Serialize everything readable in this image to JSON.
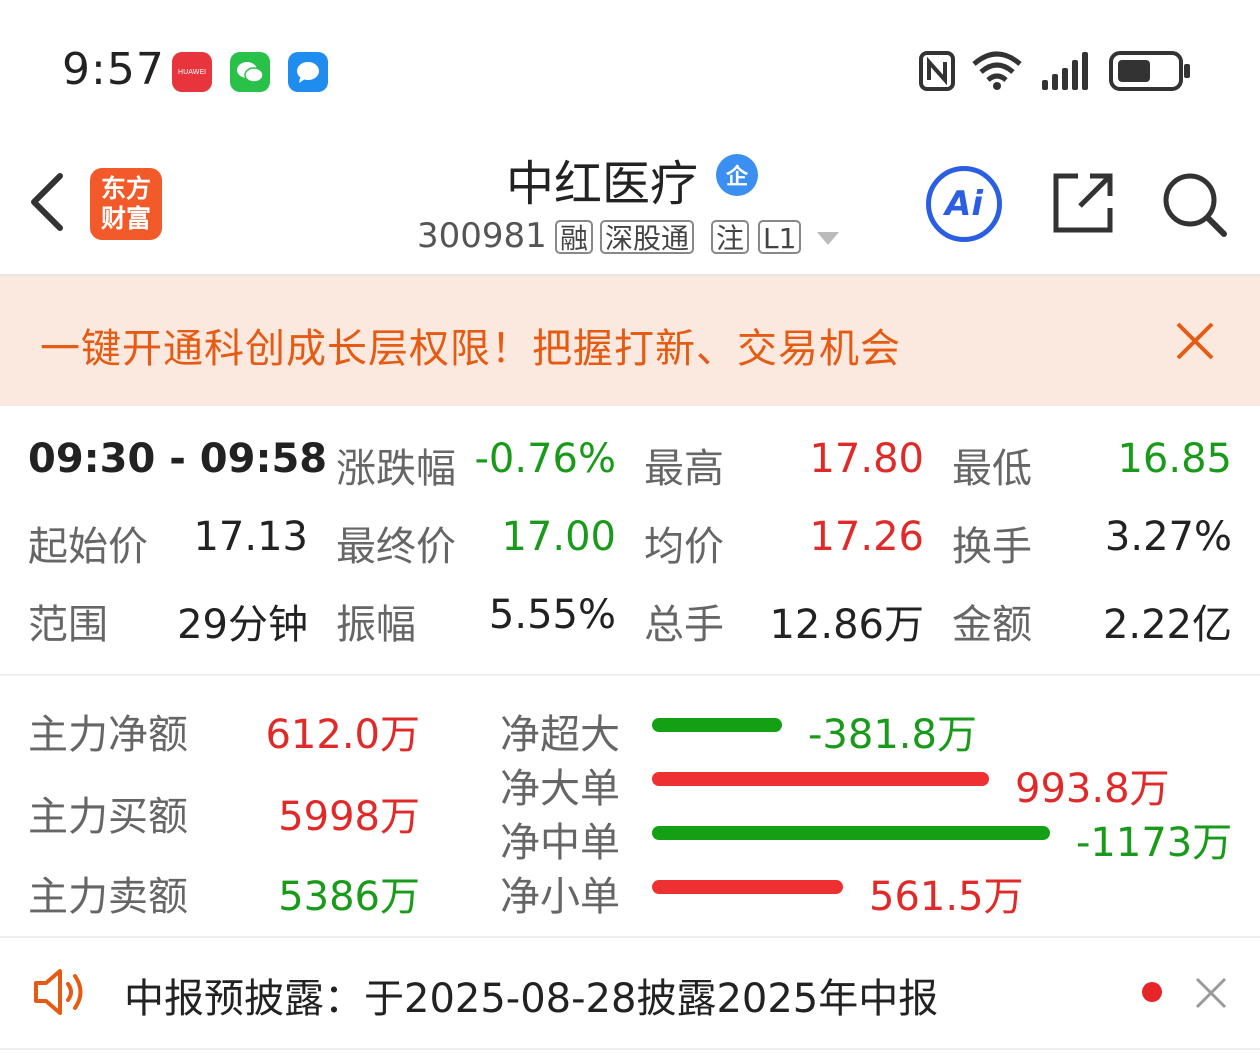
{
  "status_bar": {
    "time": "9:57",
    "apps": [
      {
        "name": "huawei-appgallery-icon",
        "label": "HUAWEI",
        "color": "#e8343c"
      },
      {
        "name": "wechat-icon",
        "color": "#29c14a"
      },
      {
        "name": "messages-icon",
        "color": "#1f8cf0"
      }
    ]
  },
  "header": {
    "logo_line1": "东方",
    "logo_line2": "财富",
    "stock_name": "中红医疗",
    "qi_badge": "企",
    "stock_code": "300981",
    "tags": [
      "融",
      "深股通",
      "注",
      "L1"
    ],
    "ai_label": "Ai"
  },
  "promo": {
    "text": "一键开通科创成长层权限！把握打新、交易机会"
  },
  "stats": {
    "range_time": "09:30 - 09:58",
    "rows": [
      [
        {
          "label": "涨跌幅",
          "value": "-0.76%",
          "color": "green"
        },
        {
          "label": "最高",
          "value": "17.80",
          "color": "red"
        },
        {
          "label": "最低",
          "value": "16.85",
          "color": "green"
        }
      ],
      [
        {
          "label": "起始价",
          "value": "17.13",
          "color": "dark"
        },
        {
          "label": "最终价",
          "value": "17.00",
          "color": "green"
        },
        {
          "label": "均价",
          "value": "17.26",
          "color": "red"
        },
        {
          "label": "换手",
          "value": "3.27%",
          "color": "dark"
        }
      ],
      [
        {
          "label": "范围",
          "value": "29分钟",
          "color": "dark"
        },
        {
          "label": "振幅",
          "value": "5.55%",
          "color": "dark"
        },
        {
          "label": "总手",
          "value": "12.86万",
          "color": "dark"
        },
        {
          "label": "金额",
          "value": "2.22亿",
          "color": "dark"
        }
      ]
    ]
  },
  "money_flow": {
    "main": [
      {
        "label": "主力净额",
        "value": "612.0万",
        "color": "red"
      },
      {
        "label": "主力买额",
        "value": "5998万",
        "color": "red"
      },
      {
        "label": "主力卖额",
        "value": "5386万",
        "color": "green"
      }
    ],
    "orders": [
      {
        "label": "净超大",
        "value": "-381.8万",
        "amount": -381.8,
        "color": "green"
      },
      {
        "label": "净大单",
        "value": "993.8万",
        "amount": 993.8,
        "color": "red"
      },
      {
        "label": "净中单",
        "value": "-1173万",
        "amount": -1173,
        "color": "green"
      },
      {
        "label": "净小单",
        "value": "561.5万",
        "amount": 561.5,
        "color": "red"
      }
    ]
  },
  "notice": {
    "text": "中报预披露：于2025-08-28披露2025年中报"
  },
  "colors": {
    "red": "#e02a2a",
    "green": "#1a9a1a",
    "bar_red": "#ee3030",
    "bar_green": "#14a014",
    "accent": "#f25a2a"
  }
}
